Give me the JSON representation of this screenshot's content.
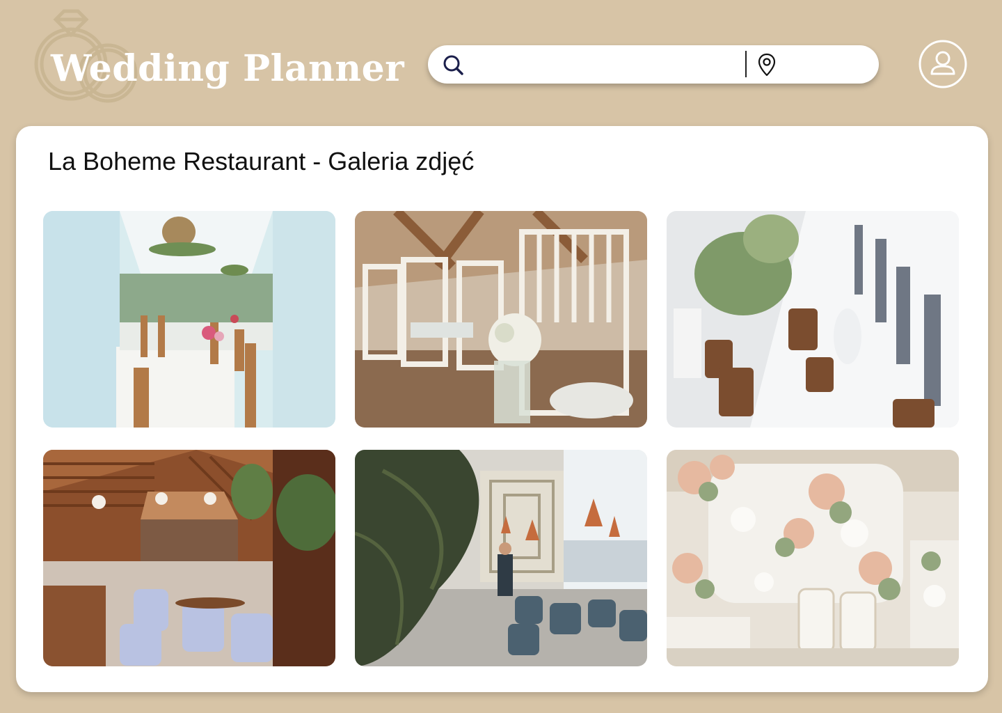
{
  "header": {
    "logo_text": "Wedding Planner",
    "search": {
      "placeholder": "",
      "value": ""
    },
    "location": {
      "placeholder": "",
      "value": ""
    },
    "icons": [
      "search-icon",
      "location-pin-icon",
      "user-icon",
      "wedding-rings-icon"
    ]
  },
  "colors": {
    "background": "#d7c4a6",
    "card": "#ffffff",
    "logo_text": "#ffffff",
    "search_icon": "#1b1f4b"
  },
  "gallery": {
    "title": "La Boheme Restaurant - Galeria zdjęć",
    "photos": [
      {
        "subject": "white tent with tables and flower decorations"
      },
      {
        "subject": "white chiavari chairs with baby's breath bouquet"
      },
      {
        "subject": "long table with wooden mugs and greenery"
      },
      {
        "subject": "restaurant with wooden slatted roof and blue chairs"
      },
      {
        "subject": "modern restaurant with monstera leaves and pendant lamps"
      },
      {
        "subject": "white floral wedding stage with thrones"
      }
    ]
  }
}
